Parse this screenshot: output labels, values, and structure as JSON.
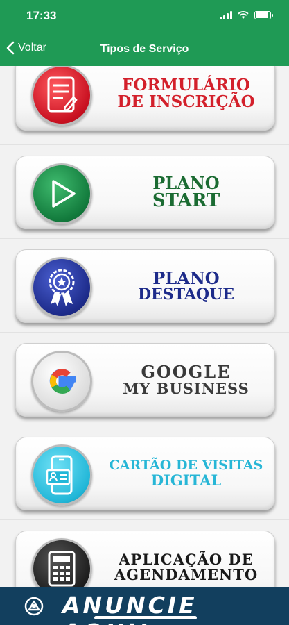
{
  "status": {
    "time": "17:33",
    "battery_level": 0.9
  },
  "nav": {
    "back_label": "Voltar",
    "title": "Tipos de Serviço"
  },
  "services": [
    {
      "line1": "FORMULÁRIO",
      "line2": "DE INSCRIÇÃO",
      "icon": "form-icon",
      "color": "#d3202b"
    },
    {
      "line1": "PLANO",
      "line2": "START",
      "icon": "play-icon",
      "color": "#1b6b32"
    },
    {
      "line1": "PLANO",
      "line2": "DESTAQUE",
      "icon": "award-icon",
      "color": "#1d2b8a"
    },
    {
      "line1": "GOOGLE",
      "line2": "MY BUSINESS",
      "icon": "google-icon",
      "color": "#3a3a3a"
    },
    {
      "line1": "CARTÃO DE VISITAS",
      "line2": "DIGITAL",
      "icon": "phone-card-icon",
      "color": "#27b6d6"
    },
    {
      "line1": "APLICAÇÃO DE",
      "line2": "AGENDAMENTO",
      "icon": "calculator-icon",
      "color": "#1a1a1a"
    }
  ],
  "banner": {
    "text": "ANUNCIE AQUI!"
  }
}
